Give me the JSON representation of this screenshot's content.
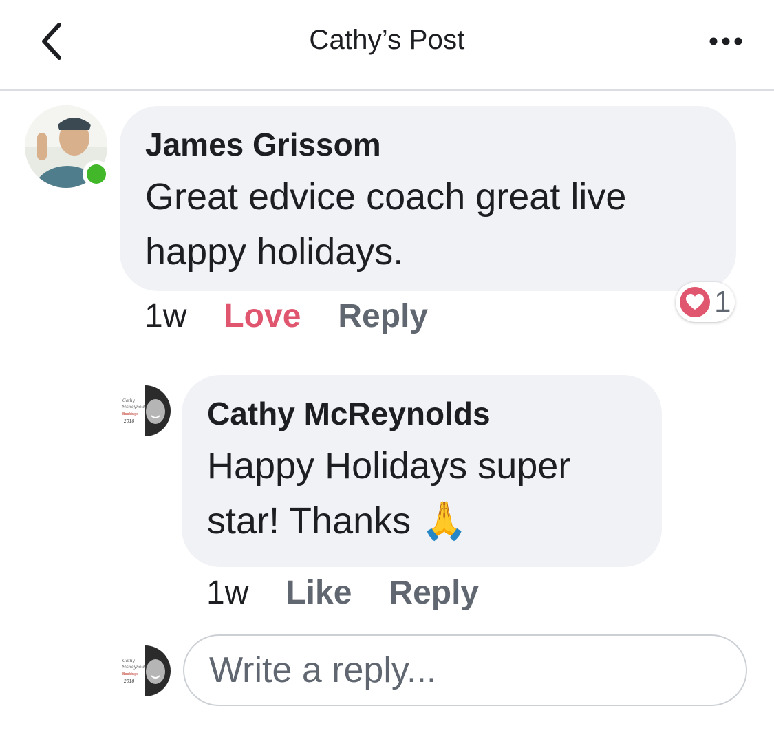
{
  "header": {
    "title": "Cathy’s Post"
  },
  "comments": [
    {
      "author": "James Grissom",
      "text_line1": "Great edvice coach great live",
      "text_line2": "happy holidays.",
      "time": "1w",
      "reaction_action": "Love",
      "reply_label": "Reply",
      "reaction_count": "1",
      "online": true
    },
    {
      "author": "Cathy McReynolds",
      "text_line1": "Happy Holidays super",
      "text_line2": "star! Thanks 🙏",
      "time": "1w",
      "like_label": "Like",
      "reply_label": "Reply"
    }
  ],
  "reply_box": {
    "placeholder": "Write a reply..."
  },
  "colors": {
    "love": "#e0566f",
    "action_gray": "#606770",
    "bubble_bg": "#f0f2f5",
    "online_green": "#42b72a"
  },
  "icons": {
    "back": "chevron-left-icon",
    "more": "more-dots-icon",
    "reaction": "heart-reaction-icon"
  }
}
